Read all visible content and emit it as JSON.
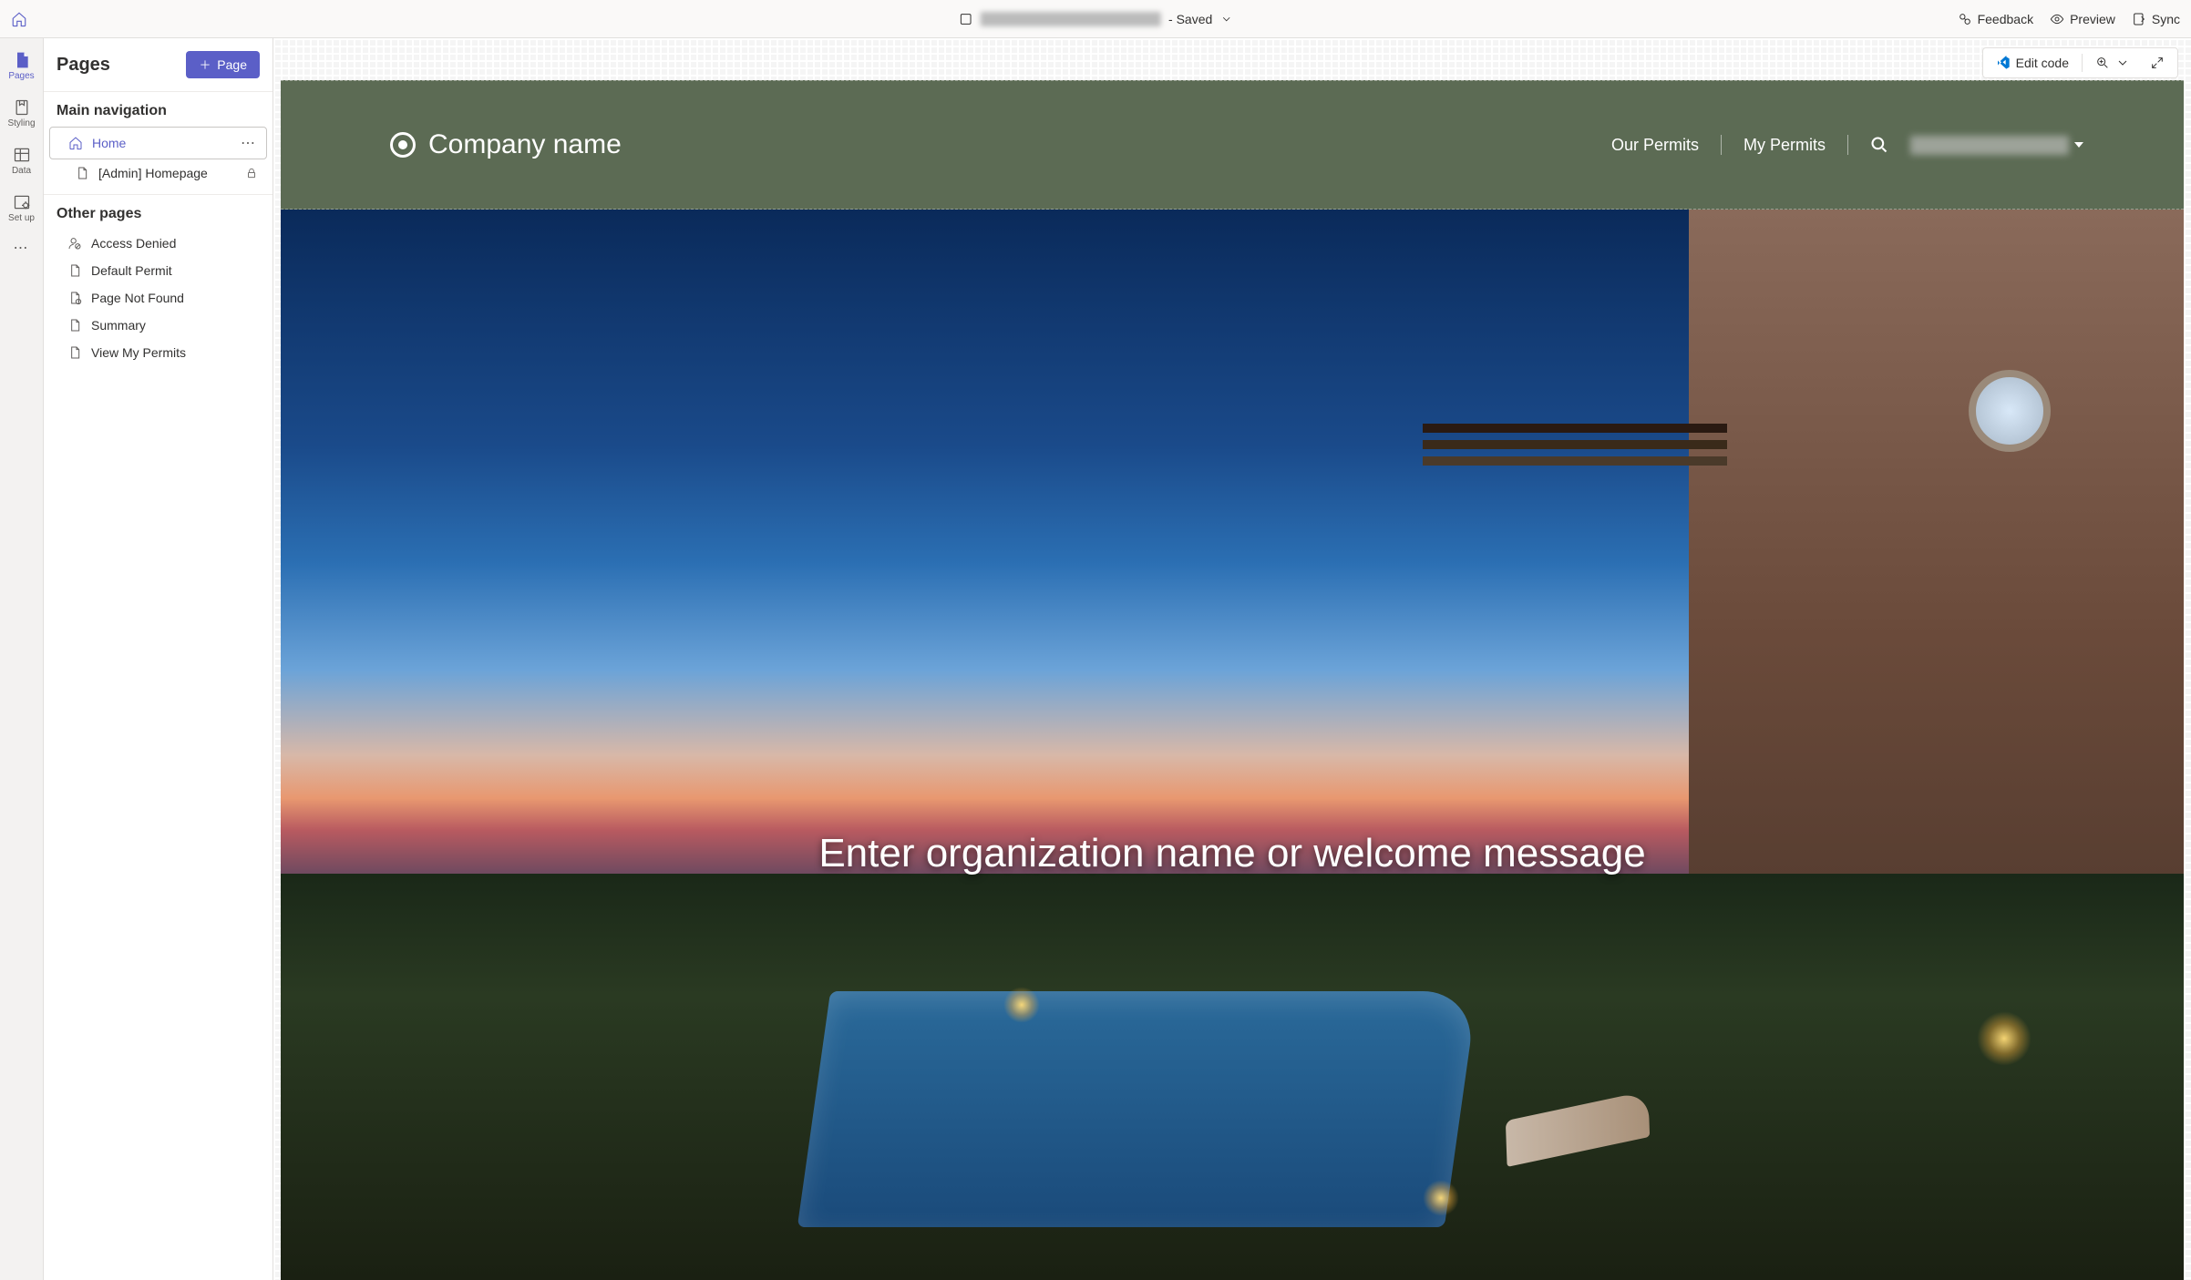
{
  "titlebar": {
    "docname_hidden": "████████ ██████ ████",
    "saved_label": "- Saved",
    "feedback": "Feedback",
    "preview": "Preview",
    "sync": "Sync"
  },
  "rail": {
    "pages": "Pages",
    "styling": "Styling",
    "data": "Data",
    "setup": "Set up"
  },
  "pages_panel": {
    "title": "Pages",
    "add_btn": "Page",
    "main_nav_hdr": "Main navigation",
    "other_hdr": "Other pages",
    "main_items": [
      {
        "label": "Home",
        "icon": "home",
        "active": true
      },
      {
        "label": "[Admin] Homepage",
        "icon": "page",
        "locked": true
      }
    ],
    "other_items": [
      {
        "label": "Access Denied",
        "icon": "person-denied"
      },
      {
        "label": "Default Permit",
        "icon": "page"
      },
      {
        "label": "Page Not Found",
        "icon": "page-warn"
      },
      {
        "label": "Summary",
        "icon": "page"
      },
      {
        "label": "View My Permits",
        "icon": "page"
      }
    ]
  },
  "canvas_toolbar": {
    "edit_code": "Edit code"
  },
  "site": {
    "brand": "Company name",
    "nav": {
      "our_permits": "Our Permits",
      "my_permits": "My Permits",
      "user_hidden": "██████ ██████"
    },
    "hero_text": "Enter organization name or welcome message"
  }
}
